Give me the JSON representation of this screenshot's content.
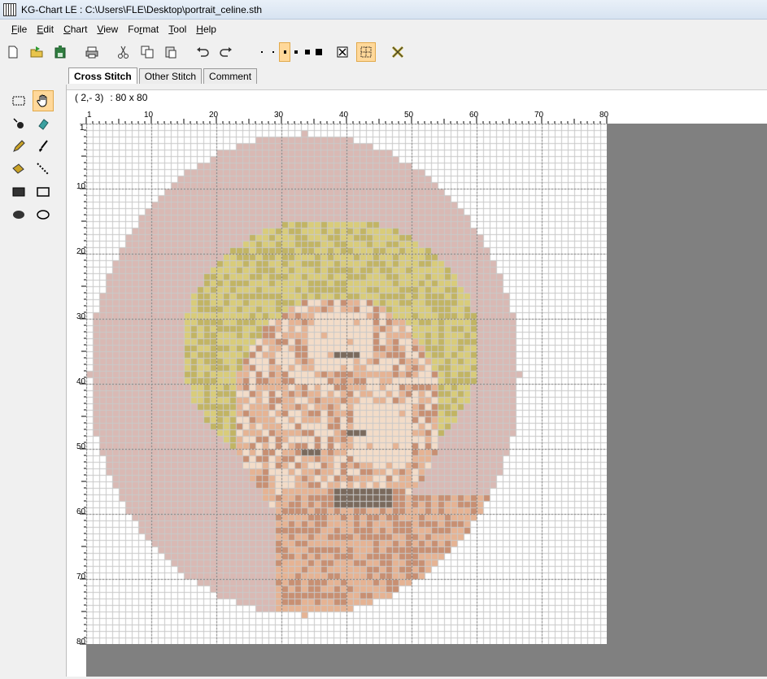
{
  "window": {
    "title": "KG-Chart LE : C:\\Users\\FLE\\Desktop\\portrait_celine.sth"
  },
  "menu": [
    {
      "u": "F",
      "rest": "ile"
    },
    {
      "u": "E",
      "rest": "dit"
    },
    {
      "u": "C",
      "rest": "hart"
    },
    {
      "u": "V",
      "rest": "iew"
    },
    {
      "pre": "Fo",
      "u": "r",
      "rest": "mat"
    },
    {
      "u": "T",
      "rest": "ool"
    },
    {
      "u": "H",
      "rest": "elp"
    }
  ],
  "tabs": [
    "Cross Stitch",
    "Other Stitch",
    "Comment"
  ],
  "status": {
    "position": "( 2,- 3)",
    "size": ": 80 x 80"
  },
  "ruler": {
    "top_labels": [
      "1",
      "10",
      "20",
      "30",
      "40",
      "50",
      "60",
      "70",
      "80"
    ],
    "left_labels": [
      "1",
      "10",
      "20",
      "30",
      "40",
      "50",
      "60",
      "70",
      "80"
    ]
  },
  "colors": {
    "background_pink": "#d9b9b4",
    "hair_yellow": "#d9cc7a",
    "hair_dark": "#c2b463",
    "skin_light": "#f3dcc8",
    "skin_mid": "#e6b393",
    "skin_shadow": "#c88f72",
    "dark_features": "#7a6a5d",
    "grid_line": "#c9c9c9",
    "grid_major": "#7a7a7a",
    "toolbar_active": "#ffd89a"
  },
  "chart_info": {
    "columns": 80,
    "rows": 80
  }
}
